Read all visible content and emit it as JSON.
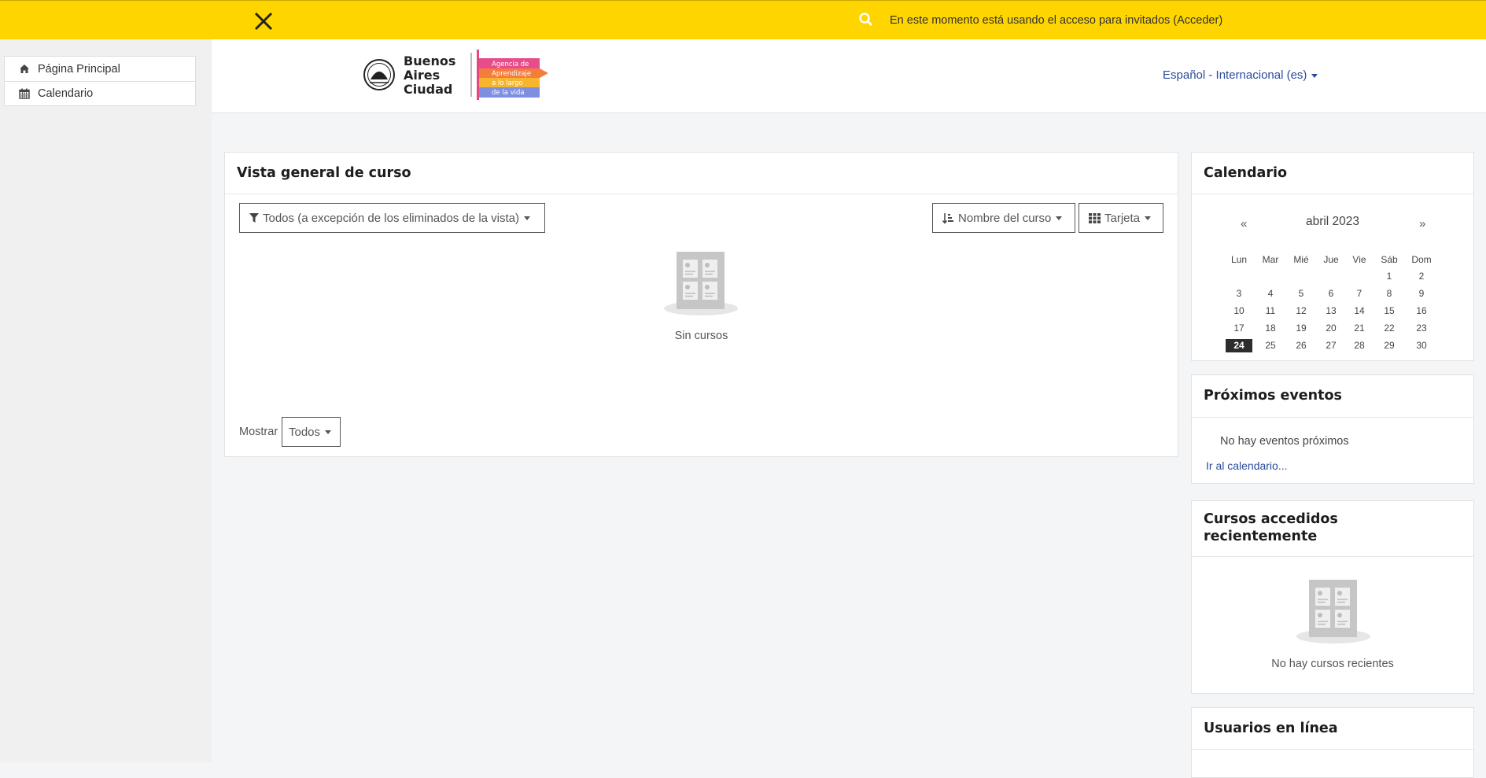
{
  "topbar": {
    "guest_text": "En este momento está usando el acceso para invitados (Acceder)",
    "bg_color": "#ffd500"
  },
  "sidebar": {
    "items": [
      {
        "label": "Página Principal",
        "icon": "home-icon"
      },
      {
        "label": "Calendario",
        "icon": "calendar-icon"
      }
    ]
  },
  "header": {
    "logo": {
      "city_line1": "Buenos",
      "city_line2": "Aires",
      "city_line3": "Ciudad",
      "agency_line1": "Agencia de",
      "agency_line2": "Aprendizaje",
      "agency_line3": "a lo largo",
      "agency_line4": "de la vida"
    },
    "language": "Español - Internacional (es)"
  },
  "course_overview": {
    "title": "Vista general de curso",
    "filter_label": "Todos (a excepción de los eliminados de la vista)",
    "sort_label": "Nombre del curso",
    "view_label": "Tarjeta",
    "empty_text": "Sin cursos",
    "show_label": "Mostrar",
    "show_value": "Todos"
  },
  "calendar": {
    "title": "Calendario",
    "prev": "«",
    "next": "»",
    "month": "abril 2023",
    "weekdays": [
      "Lun",
      "Mar",
      "Mié",
      "Jue",
      "Vie",
      "Sáb",
      "Dom"
    ],
    "weeks": [
      [
        "",
        "",
        "",
        "",
        "",
        "1",
        "2"
      ],
      [
        "3",
        "4",
        "5",
        "6",
        "7",
        "8",
        "9"
      ],
      [
        "10",
        "11",
        "12",
        "13",
        "14",
        "15",
        "16"
      ],
      [
        "17",
        "18",
        "19",
        "20",
        "21",
        "22",
        "23"
      ],
      [
        "24",
        "25",
        "26",
        "27",
        "28",
        "29",
        "30"
      ]
    ],
    "today": "24"
  },
  "upcoming": {
    "title": "Próximos eventos",
    "empty_text": "No hay eventos próximos",
    "link": "Ir al calendario..."
  },
  "recent": {
    "title": "Cursos accedidos recientemente",
    "empty_text": "No hay cursos recientes"
  },
  "online": {
    "title": "Usuarios en línea"
  }
}
